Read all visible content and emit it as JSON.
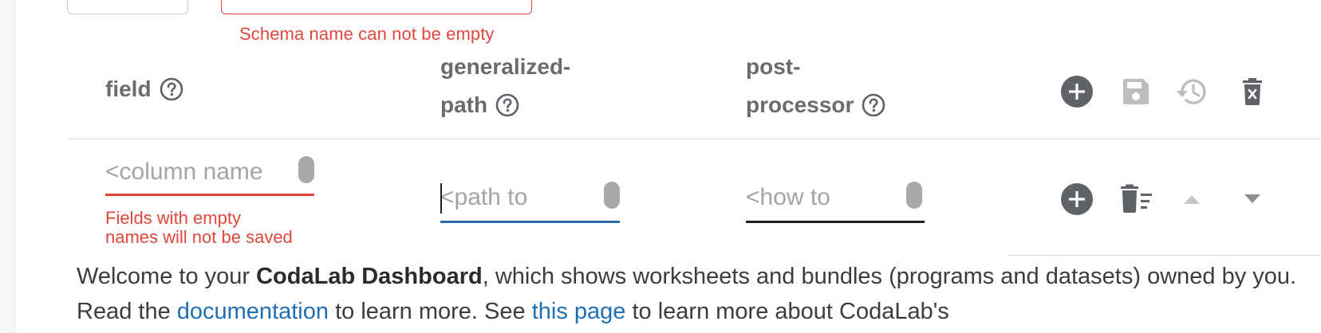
{
  "schema": {
    "error": "Schema name can not be empty"
  },
  "table": {
    "headers": [
      {
        "line1": "field",
        "line2": ""
      },
      {
        "line1": "generalized-",
        "line2": "path"
      },
      {
        "line1": "post-",
        "line2": "processor"
      }
    ],
    "header_actions": [
      "add-icon",
      "save-icon",
      "history-icon",
      "delete-icon"
    ],
    "row": {
      "field_placeholder": "<column name",
      "path_placeholder": "<path to",
      "post_placeholder": "<how to",
      "field_error_line1": "Fields with empty",
      "field_error_line2": "names will not be saved",
      "row_actions": [
        "add-icon",
        "delete-sweep-icon",
        "arrow-up-icon",
        "arrow-down-icon"
      ]
    }
  },
  "welcome": {
    "t1": "Welcome to your ",
    "bold": "CodaLab Dashboard",
    "t2": ", which shows worksheets and bundles (programs and datasets) owned by you. Read the ",
    "link1": "documentation",
    "t3": " to learn more. See ",
    "link2": "this page",
    "t4": " to learn more about CodaLab's"
  },
  "colors": {
    "error": "#e0473a",
    "link": "#1f6fb5",
    "focus_underline": "#2a6bb0",
    "icon_dark": "#5f6368",
    "icon_disabled": "#bdbdbd"
  }
}
